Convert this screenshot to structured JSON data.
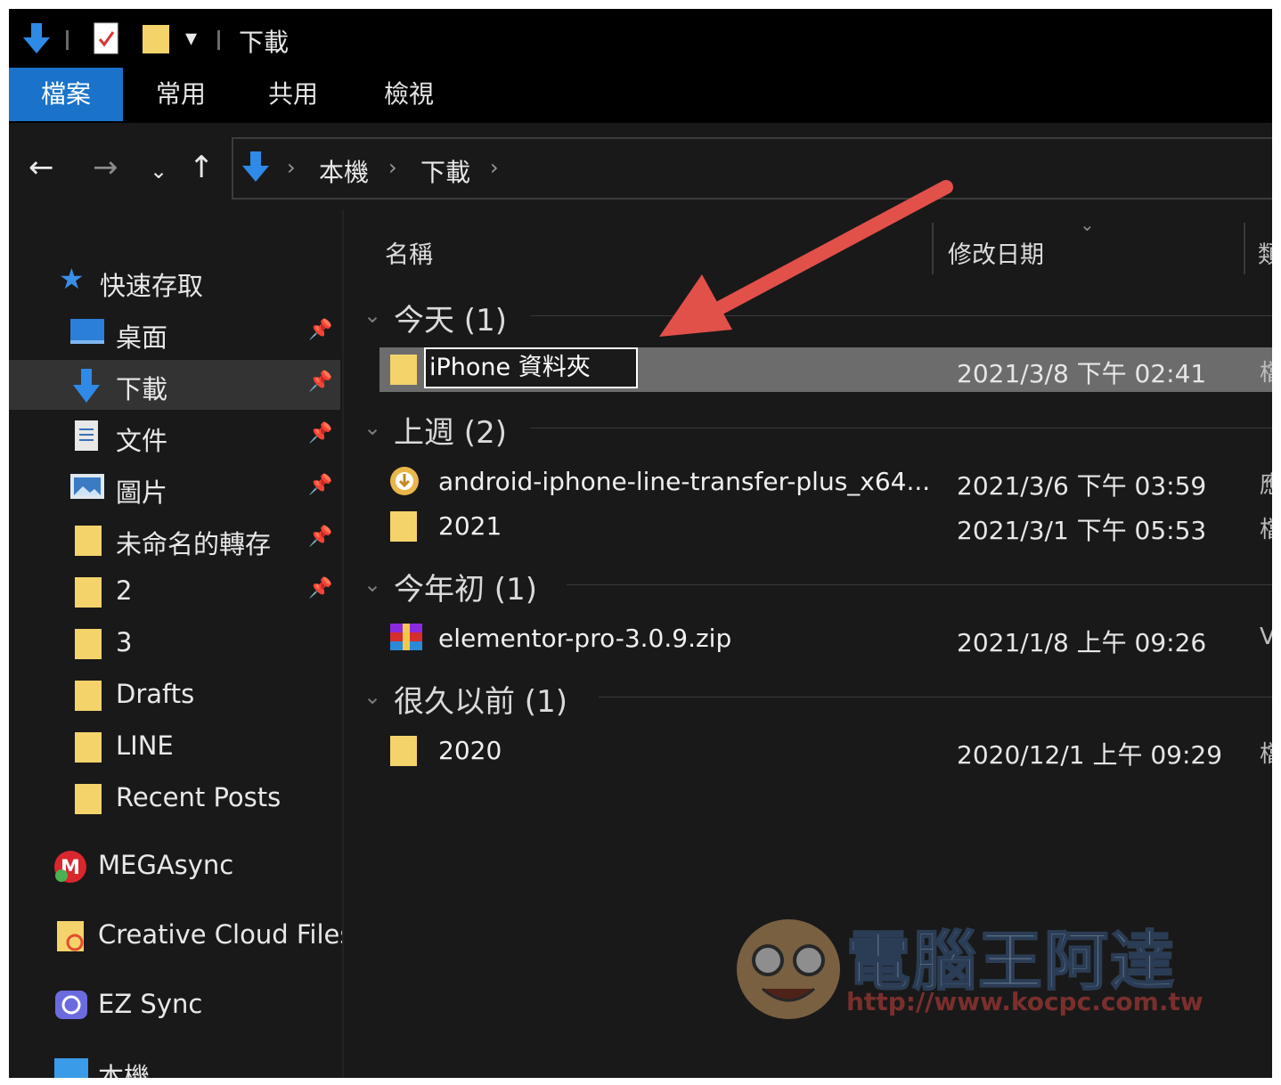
{
  "window": {
    "title": "下載"
  },
  "ribbon": {
    "tabs": [
      {
        "label": "檔案",
        "active": true
      },
      {
        "label": "常用",
        "active": false
      },
      {
        "label": "共用",
        "active": false
      },
      {
        "label": "檢視",
        "active": false
      }
    ]
  },
  "address": {
    "crumbs": [
      "本機",
      "下載"
    ]
  },
  "navpane": {
    "quick_access": "快速存取",
    "items": [
      {
        "label": "桌面",
        "icon": "desktop-icon",
        "pinned": true
      },
      {
        "label": "下載",
        "icon": "download-icon",
        "pinned": true,
        "selected": true
      },
      {
        "label": "文件",
        "icon": "document-icon",
        "pinned": true
      },
      {
        "label": "圖片",
        "icon": "pictures-icon",
        "pinned": true
      },
      {
        "label": "未命名的轉存",
        "icon": "folder-icon",
        "pinned": true
      },
      {
        "label": "2",
        "icon": "folder-icon",
        "pinned": true
      },
      {
        "label": "3",
        "icon": "folder-icon",
        "pinned": false
      },
      {
        "label": "Drafts",
        "icon": "folder-icon",
        "pinned": false
      },
      {
        "label": "LINE",
        "icon": "folder-icon",
        "pinned": false
      },
      {
        "label": "Recent Posts",
        "icon": "folder-icon",
        "pinned": false
      }
    ],
    "roots": [
      {
        "label": "MEGAsync",
        "icon": "mega-icon"
      },
      {
        "label": "Creative Cloud Files",
        "icon": "creative-cloud-icon"
      },
      {
        "label": "EZ Sync",
        "icon": "ez-sync-icon"
      },
      {
        "label": "本機",
        "icon": "computer-icon"
      }
    ]
  },
  "columns": {
    "name": "名稱",
    "modified": "修改日期"
  },
  "groups": [
    {
      "label": "今天 (1)",
      "files": [
        {
          "name": "iPhone 資料夾",
          "date": "2021/3/8 下午 02:41",
          "type": "檔",
          "icon": "folder-icon",
          "renaming": true
        }
      ]
    },
    {
      "label": "上週 (2)",
      "files": [
        {
          "name": "android-iphone-line-transfer-plus_x64...",
          "date": "2021/3/6 下午 03:59",
          "type": "應",
          "icon": "installer-icon"
        },
        {
          "name": "2021",
          "date": "2021/3/1 下午 05:53",
          "type": "檔",
          "icon": "folder-icon"
        }
      ]
    },
    {
      "label": "今年初 (1)",
      "files": [
        {
          "name": "elementor-pro-3.0.9.zip",
          "date": "2021/1/8 上午 09:26",
          "type": "V",
          "icon": "winrar-archive-icon"
        }
      ]
    },
    {
      "label": "很久以前 (1)",
      "files": [
        {
          "name": "2020",
          "date": "2020/12/1 上午 09:29",
          "type": "檔",
          "icon": "folder-icon"
        }
      ]
    }
  ],
  "watermark": {
    "title": "電腦王阿達",
    "url": "http://www.kocpc.com.tw"
  },
  "colors": {
    "accent": "#1a73c9",
    "folder": "#f5d36b",
    "annotation_arrow": "#e2504a"
  }
}
